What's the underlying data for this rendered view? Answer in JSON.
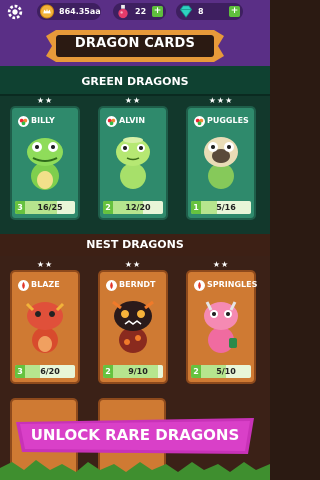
{
  "topbar": {
    "coins": "864.35aa",
    "potions": "22",
    "gems": "8",
    "plus": "+"
  },
  "title": "DRAGON CARDS",
  "sections": {
    "green": "GREEN DRAGONS",
    "nest": "NEST DRAGONS"
  },
  "cards": [
    {
      "name": "BILLY",
      "stars": "★★",
      "level": "3",
      "count": "16/25",
      "progress": 0.64
    },
    {
      "name": "ALVIN",
      "stars": "★★",
      "level": "2",
      "count": "12/20",
      "progress": 0.6
    },
    {
      "name": "PUGGLES",
      "stars": "★★★",
      "level": "1",
      "count": "5/16",
      "progress": 0.31
    },
    {
      "name": "BLAZE",
      "stars": "★★",
      "level": "3",
      "count": "6/20",
      "progress": 0.3
    },
    {
      "name": "BERNDT",
      "stars": "★★",
      "level": "2",
      "count": "9/10",
      "progress": 0.9
    },
    {
      "name": "SPRINGLES",
      "stars": "★★",
      "level": "2",
      "count": "5/10",
      "progress": 0.5
    }
  ],
  "promo": "UNLOCK RARE DRAGONS",
  "colors": {
    "purple": "#5a2f86",
    "green_card": "#2f8a6c",
    "orange_card": "#cf7a33",
    "promo_pink": "#c832b8"
  }
}
